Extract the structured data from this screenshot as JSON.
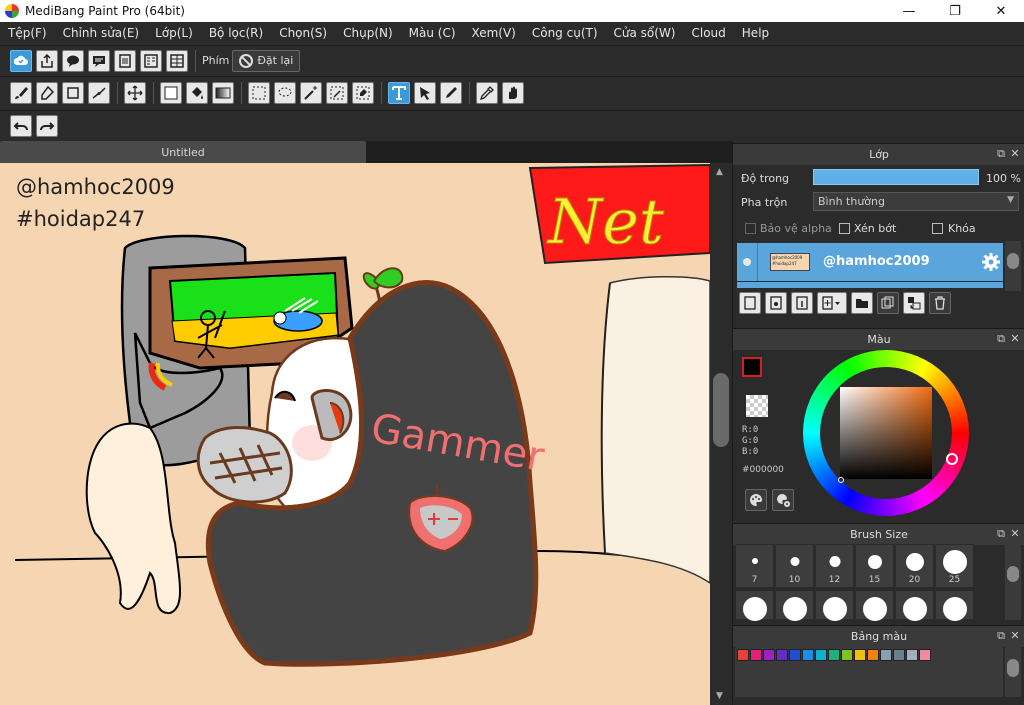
{
  "window": {
    "title": "MediBang Paint Pro (64bit)",
    "minimize": "—",
    "maximize": "❐",
    "close": "✕"
  },
  "menu": [
    "Tệp(F)",
    "Chỉnh sửa(E)",
    "Lớp(L)",
    "Bộ lọc(R)",
    "Chọn(S)",
    "Chụp(N)",
    "Màu (C)",
    "Xem(V)",
    "Công cụ(T)",
    "Cửa sổ(W)",
    "Cloud",
    "Help"
  ],
  "toolbar1": {
    "shortcut_label": "Phím",
    "reset_label": "Đặt lại"
  },
  "document": {
    "tab_title": "Untitled",
    "watermark_line1": "@hamhoc2009",
    "watermark_line2": "#hoidap247",
    "sign_text": "Net",
    "shirt_text": "Gammer"
  },
  "layer_panel": {
    "title": "Lớp",
    "opacity_label": "Độ trong",
    "opacity_value": "100 %",
    "blend_label": "Pha trộn",
    "blend_value": "Bình thường",
    "protect_alpha_label": "Bảo vệ alpha",
    "clipping_label": "Xén bớt",
    "lock_label": "Khóa",
    "layer_name": "@hamhoc2009",
    "thumb_line1": "@hamhoc2009",
    "thumb_line2": "#hoidap247"
  },
  "color_panel": {
    "title": "Màu",
    "r": "R:0",
    "g": "G:0",
    "b": "B:0",
    "hex": "#000000",
    "fg_color": "#000000",
    "accent": "#5aa6dc"
  },
  "brush_panel": {
    "title": "Brush Size",
    "sizes": [
      "7",
      "10",
      "12",
      "15",
      "20",
      "25"
    ]
  },
  "palette_panel": {
    "title": "Bảng màu",
    "swatches": [
      "#e8413c",
      "#e0207a",
      "#a020c0",
      "#6030c0",
      "#2050d0",
      "#1a8ee8",
      "#10b0d0",
      "#20b080",
      "#80c020",
      "#f0c010",
      "#f08010",
      "#8aa0b0",
      "#6a8090",
      "#a0b0c0",
      "#f08aa0"
    ]
  }
}
